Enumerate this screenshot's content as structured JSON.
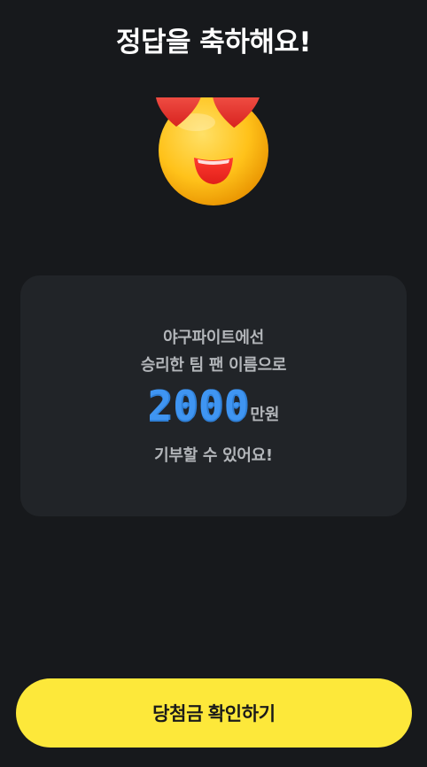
{
  "header": {
    "title": "정답을 축하해요!"
  },
  "emoji": {
    "icon": "heart-eyes-emoji-icon"
  },
  "card": {
    "line1": "야구파이트에선",
    "line2": "승리한 팀 팬 이름으로",
    "amount": "2000",
    "unit": "만원",
    "line4": "기부할 수 있어요!"
  },
  "cta": {
    "label": "당첨금 확인하기"
  },
  "colors": {
    "background": "#17191c",
    "card": "#212428",
    "accent_amount": "#3f95f2",
    "cta_background": "#fde83a"
  }
}
